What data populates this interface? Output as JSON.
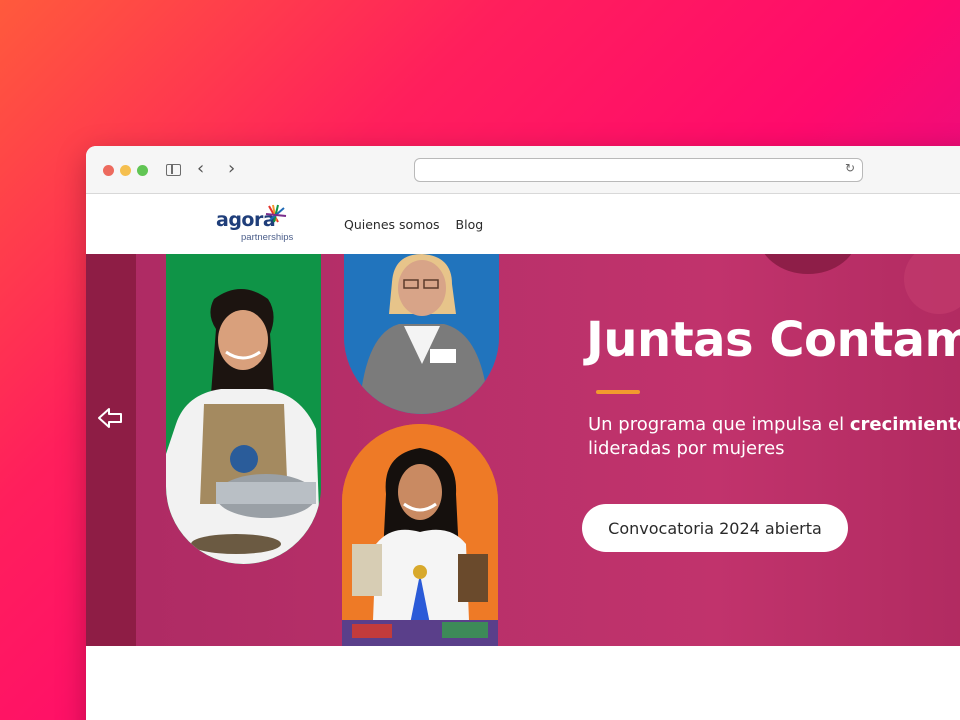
{
  "browser": {
    "url": ""
  },
  "site": {
    "logo_word": "agora",
    "logo_sub": "partnerships",
    "nav": [
      {
        "label": "Quienes somos"
      },
      {
        "label": "Blog"
      }
    ]
  },
  "hero": {
    "title": "Juntas Contam",
    "subtitle_line1_prefix": "Un programa que impulsa el ",
    "subtitle_line1_bold": "crecimiento",
    "subtitle_line2": "lideradas por mujeres",
    "cta_label": "Convocatoria 2024 abierta"
  },
  "colors": {
    "hero_bg": "#b8306a",
    "accent_line": "#f29a2e",
    "logo_blue": "#1f3e7a",
    "photo_green": "#0f9447",
    "photo_blue": "#1f69b5",
    "photo_orange": "#ee7a26"
  }
}
